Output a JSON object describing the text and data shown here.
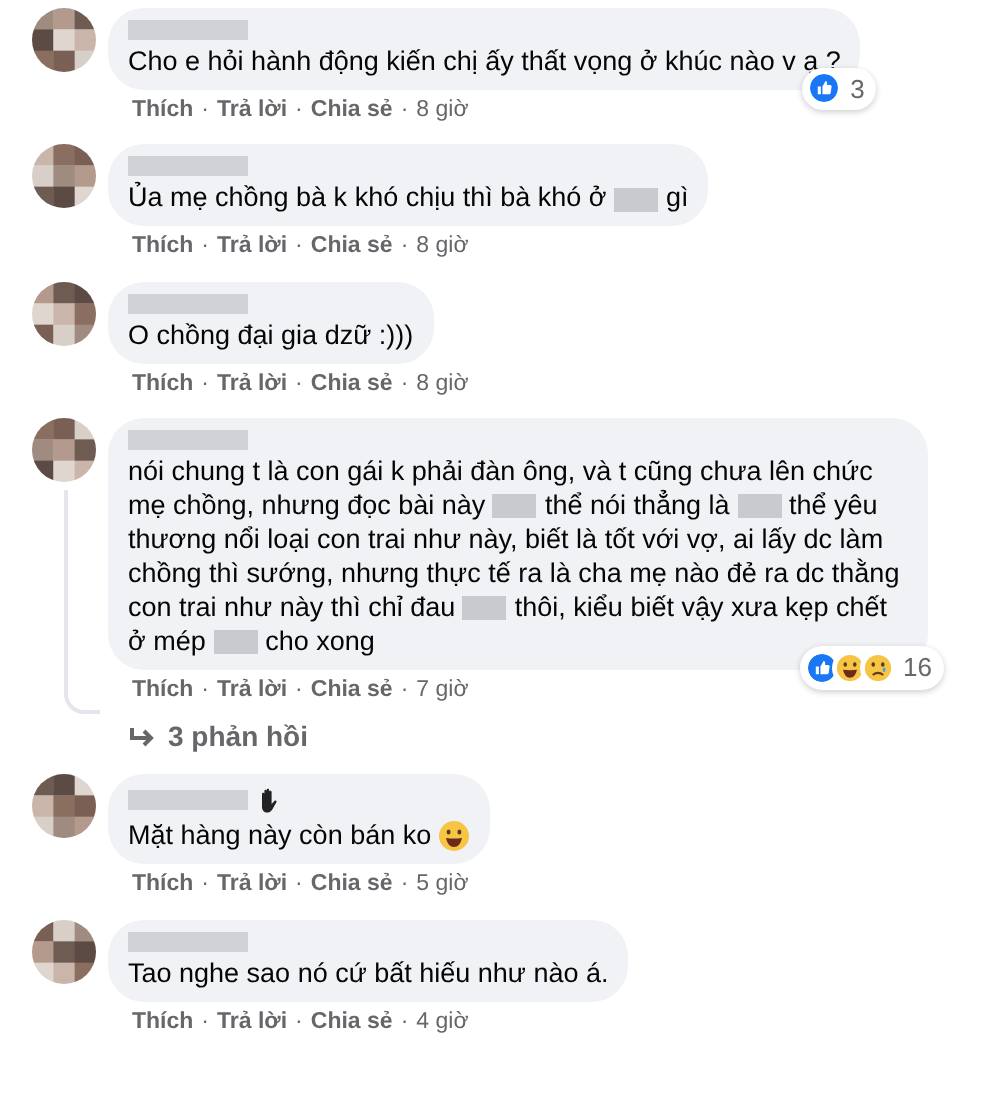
{
  "separator": "·",
  "comments": [
    {
      "segments": [
        {
          "kind": "text",
          "text": "Cho e hỏi hành động kiến chị ấy thất vọng ở khúc nào v ạ ?"
        }
      ],
      "name_badge": false,
      "reactions": {
        "types": [
          {
            "kind": "like"
          }
        ],
        "count": "3"
      },
      "actions": [
        "Thích",
        "Trả lời",
        "Chia sẻ"
      ],
      "time": "8 giờ"
    },
    {
      "segments": [
        {
          "kind": "text",
          "text": "Ủa mẹ chồng bà k khó chịu thì bà khó ở"
        },
        {
          "kind": "redacted"
        },
        {
          "kind": "text",
          "text": "gì"
        }
      ],
      "name_badge": false,
      "actions": [
        "Thích",
        "Trả lời",
        "Chia sẻ"
      ],
      "time": "8 giờ"
    },
    {
      "segments": [
        {
          "kind": "text",
          "text": "O chồng đại gia dzữ :)))"
        }
      ],
      "name_badge": false,
      "actions": [
        "Thích",
        "Trả lời",
        "Chia sẻ"
      ],
      "time": "8 giờ"
    },
    {
      "segments": [
        {
          "kind": "text",
          "text": "nói chung t là con gái k phải đàn ông, và t cũng chưa lên chức mẹ chồng, nhưng đọc bài này"
        },
        {
          "kind": "redacted"
        },
        {
          "kind": "text",
          "text": "thể nói thẳng là"
        },
        {
          "kind": "redacted"
        },
        {
          "kind": "text",
          "text": "thể yêu thương nổi loại con trai như này, biết là tốt với vợ, ai lấy dc làm chồng thì sướng, nhưng thực tế ra là cha mẹ nào đẻ ra dc thằng con trai như này thì chỉ đau"
        },
        {
          "kind": "redacted"
        },
        {
          "kind": "text",
          "text": "thôi, kiểu biết vậy xưa kẹp chết ở mép"
        },
        {
          "kind": "redacted"
        },
        {
          "kind": "text",
          "text": "cho xong"
        }
      ],
      "name_badge": false,
      "reactions": {
        "types": [
          {
            "kind": "like"
          },
          {
            "kind": "haha"
          },
          {
            "kind": "sad"
          }
        ],
        "count": "16"
      },
      "actions": [
        "Thích",
        "Trả lời",
        "Chia sẻ"
      ],
      "time": "7 giờ",
      "replies": "3 phản hồi"
    },
    {
      "segments": [
        {
          "kind": "text",
          "text": "Mặt hàng này còn bán ko"
        },
        {
          "kind": "emoji"
        }
      ],
      "name_badge": true,
      "actions": [
        "Thích",
        "Trả lời",
        "Chia sẻ"
      ],
      "time": "5 giờ"
    },
    {
      "segments": [
        {
          "kind": "text",
          "text": "Tao nghe sao nó cứ bất hiếu như nào á."
        }
      ],
      "name_badge": false,
      "actions": [
        "Thích",
        "Trả lời",
        "Chia sẻ"
      ],
      "time": "4 giờ"
    }
  ]
}
